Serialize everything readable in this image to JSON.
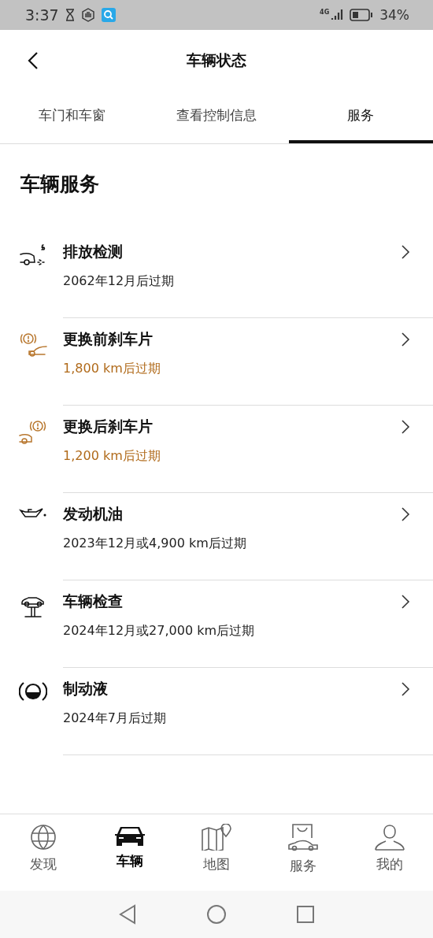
{
  "status_bar": {
    "time": "3:37",
    "network": "4G",
    "battery": "34%"
  },
  "header": {
    "title": "车辆状态"
  },
  "tabs": [
    {
      "label": "车门和车窗",
      "selected": false
    },
    {
      "label": "查看控制信息",
      "selected": false
    },
    {
      "label": "服务",
      "selected": true
    }
  ],
  "section": {
    "title": "车辆服务"
  },
  "services": [
    {
      "kind": "emissions",
      "title": "排放检测",
      "due": "2062年12月后过期",
      "warning": false
    },
    {
      "kind": "front-brake",
      "title": "更换前刹车片",
      "due": "1,800 km后过期",
      "warning": true
    },
    {
      "kind": "rear-brake",
      "title": "更换后刹车片",
      "due": "1,200 km后过期",
      "warning": true
    },
    {
      "kind": "oil",
      "title": "发动机油",
      "due": "2023年12月或4,900 km后过期",
      "warning": false
    },
    {
      "kind": "inspection",
      "title": "车辆检查",
      "due": "2024年12月或27,000 km后过期",
      "warning": false
    },
    {
      "kind": "brake-fluid",
      "title": "制动液",
      "due": "2024年7月后过期",
      "warning": false
    }
  ],
  "bottom_nav": [
    {
      "kind": "globe",
      "label": "发现",
      "selected": false
    },
    {
      "kind": "car",
      "label": "车辆",
      "selected": true
    },
    {
      "kind": "map",
      "label": "地图",
      "selected": false
    },
    {
      "kind": "shop",
      "label": "服务",
      "selected": false
    },
    {
      "kind": "person",
      "label": "我的",
      "selected": false
    }
  ]
}
